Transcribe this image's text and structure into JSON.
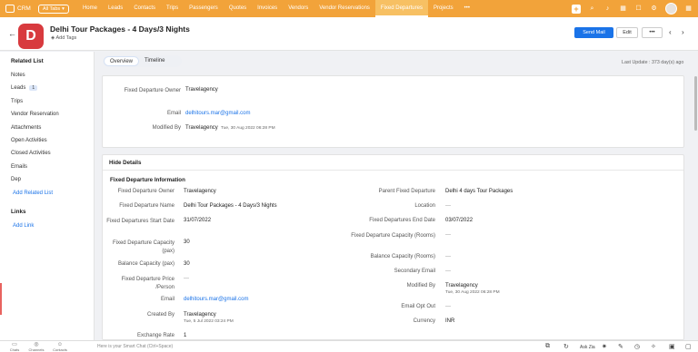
{
  "topnav": {
    "logo": "CRM",
    "all_tabs": "All Tabs",
    "tabs": [
      "Home",
      "Leads",
      "Contacts",
      "Trips",
      "Passengers",
      "Quotes",
      "Invoices",
      "Vendors",
      "Vendor Reservations",
      "Fixed Departures",
      "Projects"
    ],
    "more": "•••",
    "active_tab": "Fixed Departures",
    "accent": "#f2a33a"
  },
  "header": {
    "logo_letter": "D",
    "title": "Delhi Tour Packages - 4 Days/3 Nights",
    "add_tags": "Add Tags",
    "send_mail": "Send Mail",
    "edit": "Edit",
    "more": "•••"
  },
  "sidebar": {
    "related_list": "Related List",
    "items": [
      {
        "label": "Notes"
      },
      {
        "label": "Leads",
        "badge": "1"
      },
      {
        "label": "Trips"
      },
      {
        "label": "Vendor Reservation"
      },
      {
        "label": "Attachments"
      },
      {
        "label": "Open Activities"
      },
      {
        "label": "Closed Activities"
      },
      {
        "label": "Emails"
      },
      {
        "label": "Dep"
      }
    ],
    "add_related": "Add Related List",
    "links": "Links",
    "add_link": "Add Link"
  },
  "tabs": {
    "overview": "Overview",
    "timeline": "Timeline"
  },
  "last_update": "Last Update : 373 day(s) ago",
  "summary": {
    "owner_label": "Fixed Departure Owner",
    "owner": "Travelagency",
    "email_label": "Email",
    "email": "delhitours.mar@gmail.com",
    "modified_label": "Modified By",
    "modified_by": "Travelagency",
    "modified_time": "Tue, 30 Aug 2022 06:28 PM"
  },
  "details": {
    "hide": "Hide Details",
    "section": "Fixed Departure Information",
    "left": [
      {
        "label": "Fixed Departure Owner",
        "value": "Travelagency"
      },
      {
        "label": "Fixed Departure Name",
        "value": "Delhi Tour Packages - 4 Days/3 Nights"
      },
      {
        "label": "Fixed Departures Start Date",
        "value": "31/07/2022"
      },
      {
        "label": "Fixed Departure Capacity (pax)",
        "value": "30"
      },
      {
        "label": "Balance Capacity (pax)",
        "value": "30"
      },
      {
        "label": "Fixed Departure Price /Person",
        "value": "—"
      },
      {
        "label": "Email",
        "value": "delhitours.mar@gmail.com"
      },
      {
        "label": "Created By",
        "value": "Travelagency",
        "sub": "Tue, 5 Jul 2022 03:24 PM"
      },
      {
        "label": "Exchange Rate",
        "value": "1"
      }
    ],
    "right": [
      {
        "label": "Parent Fixed Departure",
        "value": "Delhi 4 days Tour Packages"
      },
      {
        "label": "Location",
        "value": "—"
      },
      {
        "label": "Fixed Departures End Date",
        "value": "03/07/2022"
      },
      {
        "label": "Fixed Departure Capacity (Rooms)",
        "value": "—"
      },
      {
        "label": "Balance Capacity (Rooms)",
        "value": "—"
      },
      {
        "label": "Secondary Email",
        "value": "—"
      },
      {
        "label": "Modified By",
        "value": "Travelagency",
        "sub": "Tue, 30 Aug 2022 06:28 PM"
      },
      {
        "label": "Email Opt Out",
        "value": "—"
      },
      {
        "label": "Currency",
        "value": "INR"
      }
    ]
  },
  "bottombar": {
    "items": [
      "Chats",
      "Channels",
      "Contacts"
    ],
    "chat_placeholder": "Here is your Smart Chat (Ctrl+Space)",
    "ask_zia": "Ask Zia"
  }
}
